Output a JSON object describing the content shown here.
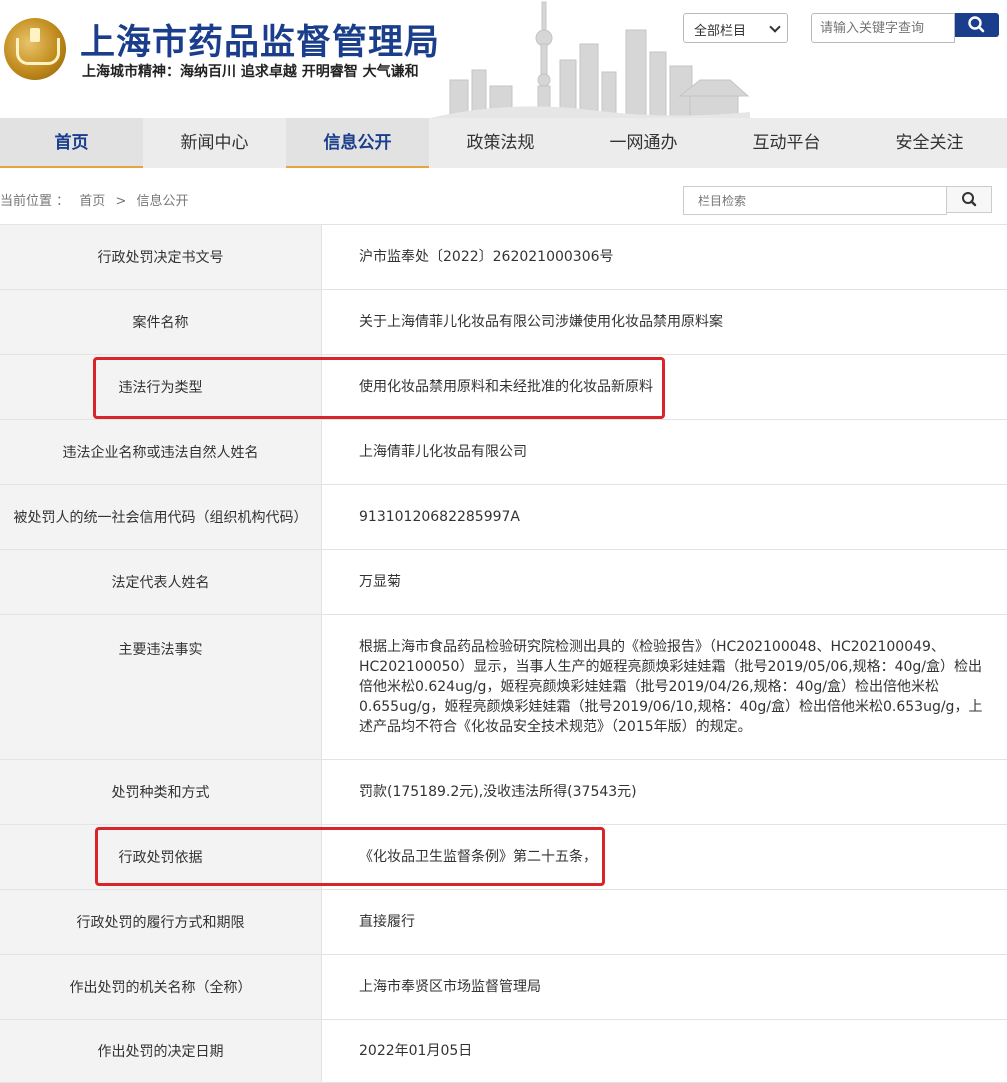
{
  "header": {
    "title": "上海市药品监督管理局",
    "slogan": "上海城市精神：海纳百川  追求卓越  开明睿智  大气谦和",
    "column_select": "全部栏目",
    "search_placeholder": "请输入关键字查询"
  },
  "nav": {
    "items": [
      "首页",
      "新闻中心",
      "信息公开",
      "政策法规",
      "一网通办",
      "互动平台",
      "安全关注"
    ]
  },
  "breadcrumb": {
    "prefix": "当前位置 ：",
    "home": "首页",
    "sep": ">",
    "current": "信息公开"
  },
  "column_search": {
    "placeholder": "栏目检索"
  },
  "table": {
    "rows": [
      {
        "label": "行政处罚决定书文号",
        "value": "沪市监奉处〔2022〕262021000306号"
      },
      {
        "label": "案件名称",
        "value": "关于上海倩菲儿化妆品有限公司涉嫌使用化妆品禁用原料案"
      },
      {
        "label": "违法行为类型",
        "value": "使用化妆品禁用原料和未经批准的化妆品新原料"
      },
      {
        "label": "违法企业名称或违法自然人姓名",
        "value": "上海倩菲儿化妆品有限公司"
      },
      {
        "label": "被处罚人的统一社会信用代码（组织机构代码）",
        "value": "91310120682285997A"
      },
      {
        "label": "法定代表人姓名",
        "value": "万显菊"
      },
      {
        "label": "主要违法事实",
        "value": "根据上海市食品药品检验研究院检测出具的《检验报告》（HC202100048、HC202100049、HC202100050）显示，当事人生产的姬程亮颜焕彩娃娃霜（批号2019/05/06,规格：40g/盒）检出倍他米松0.624ug/g，姬程亮颜焕彩娃娃霜（批号2019/04/26,规格：40g/盒）检出倍他米松0.655ug/g，姬程亮颜焕彩娃娃霜（批号2019/06/10,规格：40g/盒）检出倍他米松0.653ug/g，上述产品均不符合《化妆品安全技术规范》（2015年版）的规定。"
      },
      {
        "label": "处罚种类和方式",
        "value": "罚款(175189.2元),没收违法所得(37543元)"
      },
      {
        "label": "行政处罚依据",
        "value": "《化妆品卫生监督条例》第二十五条，"
      },
      {
        "label": "行政处罚的履行方式和期限",
        "value": "直接履行"
      },
      {
        "label": "作出处罚的机关名称（全称）",
        "value": "上海市奉贤区市场监督管理局"
      },
      {
        "label": "作出处罚的决定日期",
        "value": "2022年01月05日"
      }
    ]
  },
  "colors": {
    "brand": "#1a3e8c",
    "nav_accent": "#e8a33d",
    "highlight": "#d9252a"
  }
}
